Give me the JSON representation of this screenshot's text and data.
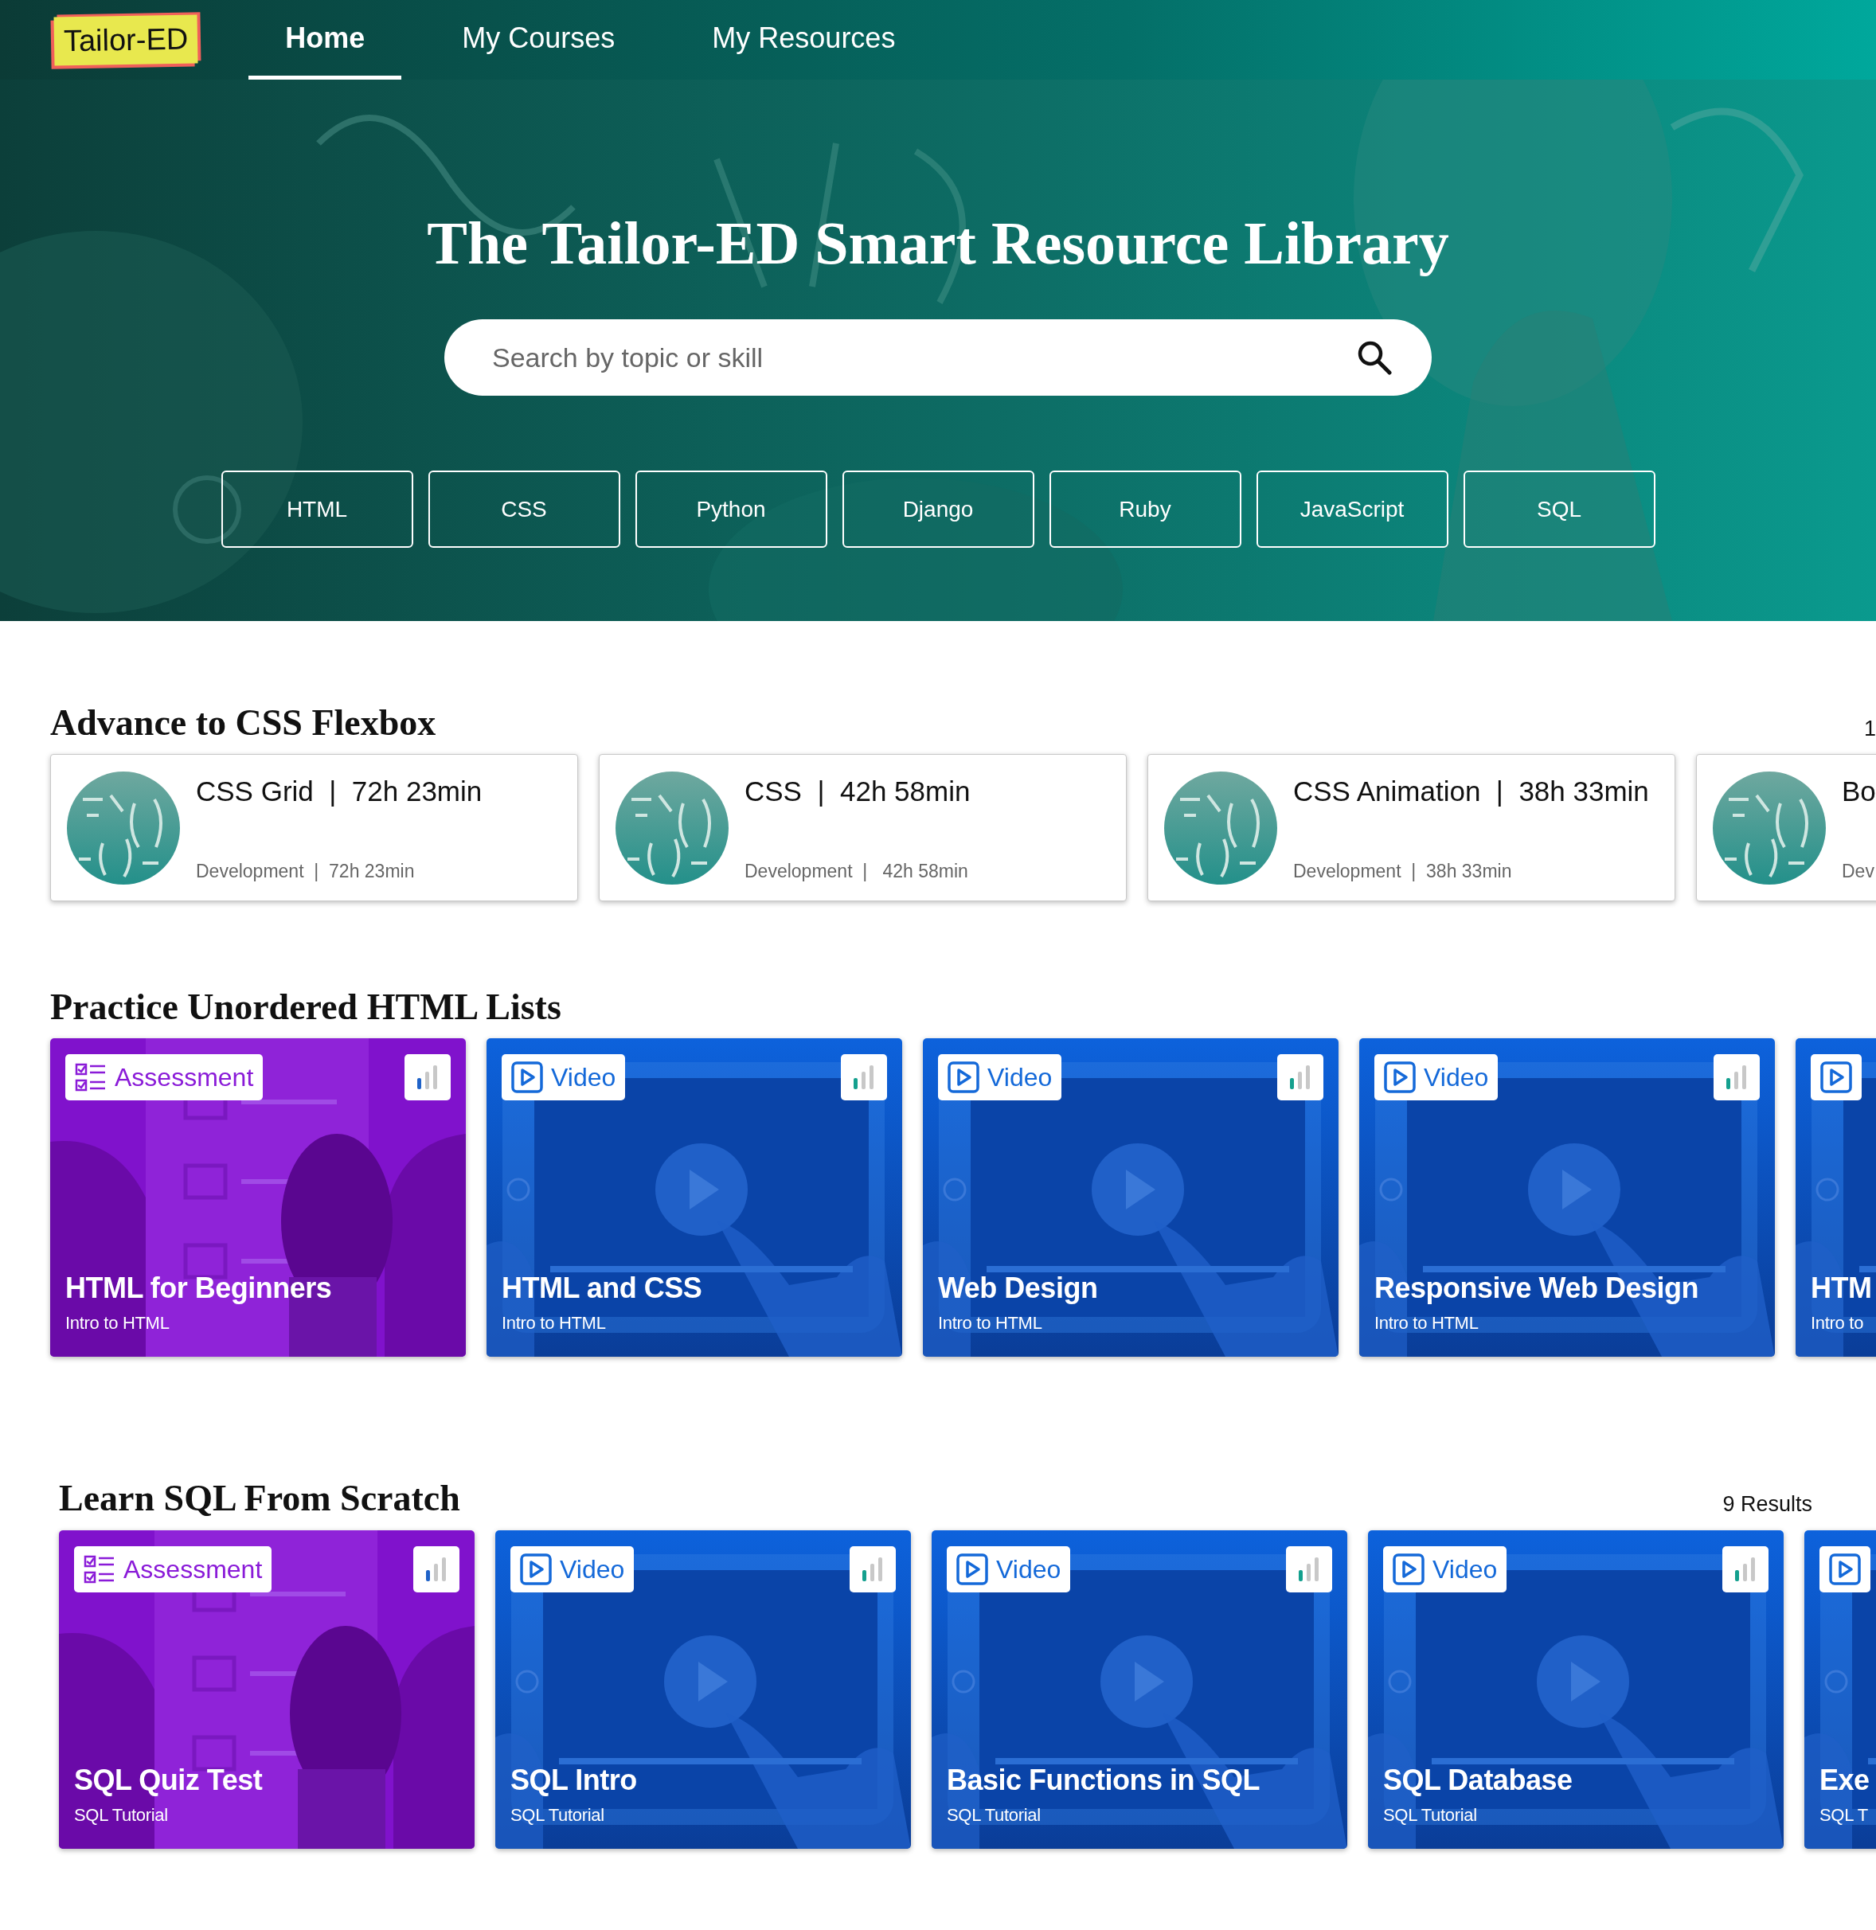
{
  "nav": {
    "logo": "Tailor-ED",
    "links": [
      {
        "label": "Home",
        "selected": true
      },
      {
        "label": "My Courses",
        "selected": false
      },
      {
        "label": "My Resources",
        "selected": false
      }
    ]
  },
  "hero": {
    "title": "The Tailor-ED Smart Resource Library",
    "search": {
      "placeholder": "Search by topic or skill"
    },
    "topics": [
      "HTML",
      "CSS",
      "Python",
      "Django",
      "Ruby",
      "JavaScript",
      "SQL"
    ]
  },
  "sections": [
    {
      "kind": "courses",
      "title": "Advance to CSS Flexbox",
      "count": "1",
      "items": [
        {
          "title": "CSS Grid  |  72h 23min",
          "meta": "Development  |  72h 23min"
        },
        {
          "title": "CSS  |  42h 58min",
          "meta": "Development  |   42h 58min"
        },
        {
          "title": "CSS Animation  |  38h 33min",
          "meta": "Development  |  38h 33min"
        },
        {
          "title": "Bo",
          "meta": "Dev"
        }
      ]
    },
    {
      "kind": "resources",
      "title": "Practice Unordered HTML Lists",
      "items": [
        {
          "kind": "assessment",
          "tag": "Assessment",
          "title": "HTML for Beginners",
          "subtitle": "Intro to HTML"
        },
        {
          "kind": "video",
          "tag": "Video",
          "title": "HTML and CSS",
          "subtitle": "Intro to HTML"
        },
        {
          "kind": "video",
          "tag": "Video",
          "title": "Web Design",
          "subtitle": "Intro to HTML"
        },
        {
          "kind": "video",
          "tag": "Video",
          "title": "Responsive Web Design",
          "subtitle": "Intro to HTML"
        },
        {
          "kind": "video",
          "title": "HTM",
          "subtitle": "Intro to"
        }
      ]
    },
    {
      "kind": "resources",
      "title": "Learn SQL From Scratch",
      "count": "9 Results",
      "items": [
        {
          "kind": "assessment",
          "tag": "Assessment",
          "title": "SQL Quiz Test",
          "subtitle": "SQL Tutorial"
        },
        {
          "kind": "video",
          "tag": "Video",
          "title": "SQL Intro",
          "subtitle": "SQL Tutorial"
        },
        {
          "kind": "video",
          "tag": "Video",
          "title": "Basic Functions in SQL",
          "subtitle": "SQL Tutorial"
        },
        {
          "kind": "video",
          "tag": "Video",
          "title": "SQL Database",
          "subtitle": "SQL Tutorial"
        },
        {
          "kind": "video",
          "title": "Exe",
          "subtitle": "SQL T"
        }
      ]
    }
  ]
}
